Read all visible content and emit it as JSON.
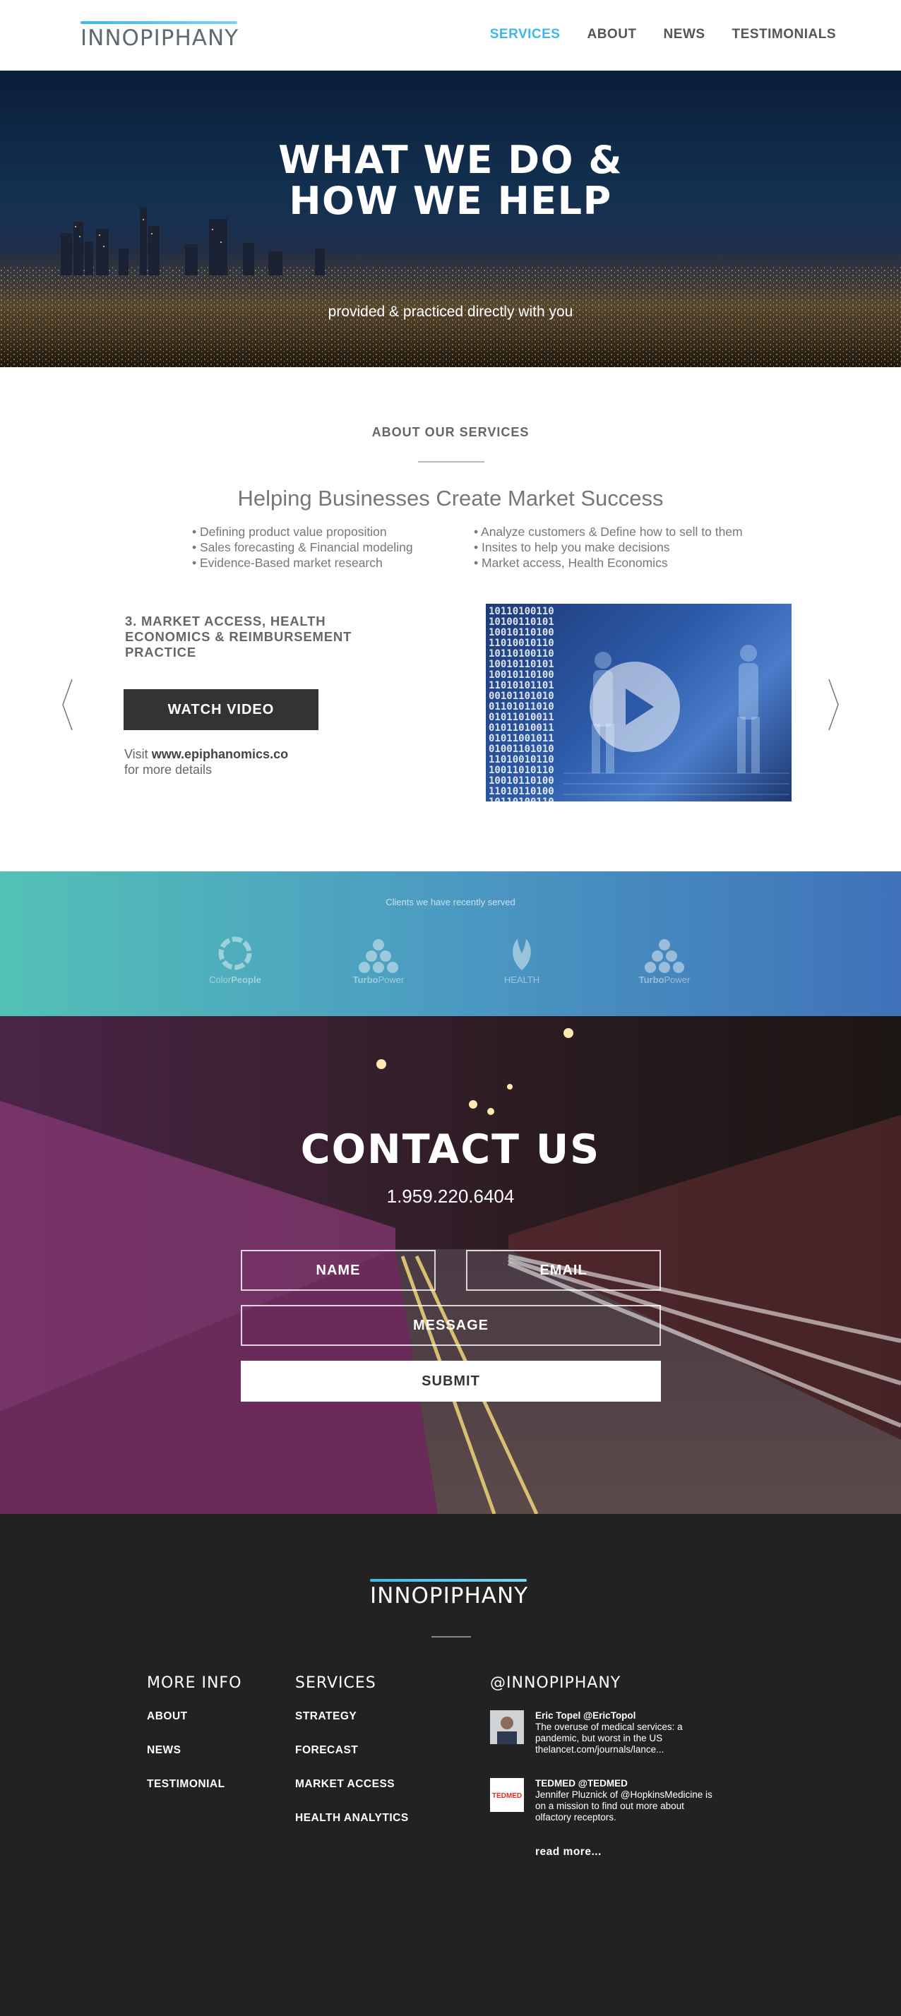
{
  "nav": {
    "logo": "INNOPIPHANY",
    "items": [
      {
        "label": "SERVICES",
        "active": true
      },
      {
        "label": "ABOUT"
      },
      {
        "label": "NEWS"
      },
      {
        "label": "TESTIMONIALS"
      }
    ]
  },
  "hero": {
    "title_line1": "WHAT WE DO &",
    "title_line2": "HOW WE HELP",
    "subtitle": "provided & practiced directly with you"
  },
  "about": {
    "kicker": "ABOUT OUR SERVICES",
    "heading": "Helping Businesses Create Market Success",
    "bullets_left": [
      "Defining product value proposition",
      "Sales forecasting & Financial modeling",
      "Evidence-Based market research"
    ],
    "bullets_right": [
      "Analyze customers & Define how to sell to them",
      "Insites to help you make decisions",
      "Market access, Health Economics"
    ],
    "slide": {
      "title": "3. MARKET ACCESS, HEALTH ECONOMICS & REIMBURSEMENT PRACTICE",
      "button": "WATCH VIDEO",
      "visit_prefix": "Visit",
      "visit_link": "www.epiphanomics.co",
      "visit_suffix": "for more details"
    }
  },
  "clients": {
    "caption": "Clients we have recently served",
    "logos": [
      {
        "name": "ColorPeople",
        "part1": "Color",
        "part2": "People"
      },
      {
        "name": "TurboPower",
        "part1": "Turbo",
        "part2": "Power"
      },
      {
        "name": "HEALTH",
        "part1": "HEALTH",
        "part2": ""
      },
      {
        "name": "TurboPower",
        "part1": "Turbo",
        "part2": "Power"
      }
    ]
  },
  "contact": {
    "title": "CONTACT US",
    "phone": "1.959.220.6404",
    "name_placeholder": "NAME",
    "email_placeholder": "EMAIL",
    "message_placeholder": "MESSAGE",
    "submit": "SUBMIT"
  },
  "footer": {
    "logo": "INNOPIPHANY",
    "more_info": {
      "heading": "MORE INFO",
      "links": [
        "ABOUT",
        "NEWS",
        "TESTIMONIAL"
      ]
    },
    "services": {
      "heading": "SERVICES",
      "links": [
        "STRATEGY",
        "FORECAST",
        "MARKET ACCESS",
        "HEALTH ANALYTICS"
      ]
    },
    "twitter": {
      "heading": "@INNOPIPHANY",
      "tweets": [
        {
          "author": "Eric Topel @EricTopol",
          "text": "The overuse of medical services: a pandemic, but worst in the US thelancet.com/journals/lance..."
        },
        {
          "author": "TEDMED @TEDMED",
          "text": "Jennifer Pluznick of @HopkinsMedicine is on a mission to find out more about olfactory receptors.",
          "avatar_text": "TEDMED"
        }
      ],
      "read_more": "read more..."
    }
  }
}
